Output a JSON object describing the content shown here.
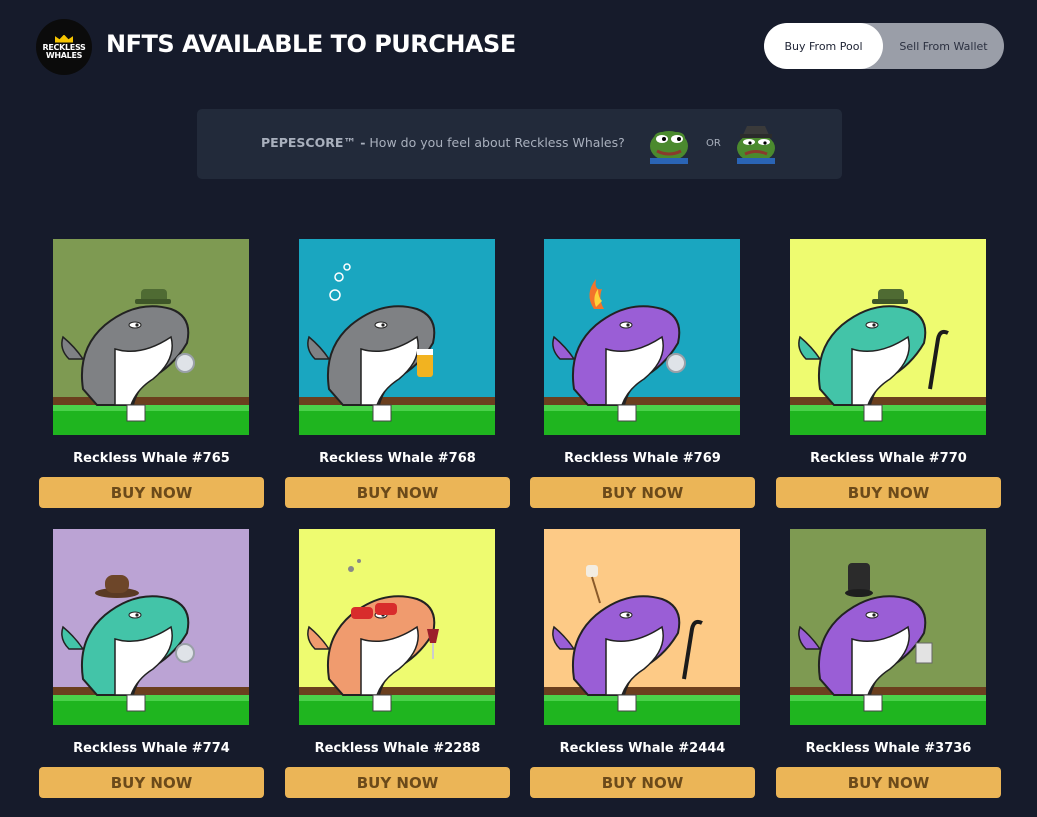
{
  "header": {
    "logo_text_line1": "RECKLESS",
    "logo_text_line2": "WHALES",
    "title": "NFTS AVAILABLE TO PURCHASE",
    "toggle": {
      "buy_label": "Buy From Pool",
      "sell_label": "Sell From Wallet",
      "active": "buy"
    }
  },
  "pepescore": {
    "brand": "PEPESCORE™ -",
    "question": "How do you feel about Reckless Whales?",
    "or_label": "OR"
  },
  "nfts": [
    {
      "name": "Reckless Whale #765",
      "buy_label": "BUY NOW",
      "bg": "#7e9a52",
      "body": "#7f8184",
      "hat": "cap",
      "item": "coin"
    },
    {
      "name": "Reckless Whale #768",
      "buy_label": "BUY NOW",
      "bg": "#1aa6c0",
      "body": "#7f8184",
      "hat": "bubbles",
      "item": "beer"
    },
    {
      "name": "Reckless Whale #769",
      "buy_label": "BUY NOW",
      "bg": "#1aa6c0",
      "body": "#9a5ed6",
      "hat": "fire",
      "item": "coin"
    },
    {
      "name": "Reckless Whale #770",
      "buy_label": "BUY NOW",
      "bg": "#eefb70",
      "body": "#43c4a8",
      "hat": "cap",
      "item": "cane"
    },
    {
      "name": "Reckless Whale #774",
      "buy_label": "BUY NOW",
      "bg": "#bba3d4",
      "body": "#43c4a8",
      "hat": "cowboy",
      "item": "coin"
    },
    {
      "name": "Reckless Whale #2288",
      "buy_label": "BUY NOW",
      "bg": "#eefb70",
      "body": "#f09b6e",
      "hat": "sunglasses",
      "item": "wine"
    },
    {
      "name": "Reckless Whale #2444",
      "buy_label": "BUY NOW",
      "bg": "#fdca86",
      "body": "#9a5ed6",
      "hat": "marshmallow",
      "item": "cane"
    },
    {
      "name": "Reckless Whale #3736",
      "buy_label": "BUY NOW",
      "bg": "#7e9a52",
      "body": "#9a5ed6",
      "hat": "tophat",
      "item": "cards"
    }
  ],
  "colors": {
    "background": "#161b2b",
    "panel": "#222a3a",
    "buy_button": "#ebb557",
    "buy_button_text": "#6b4a1a",
    "table_green": "#1fb51f",
    "table_wood": "#6b3f1e"
  }
}
